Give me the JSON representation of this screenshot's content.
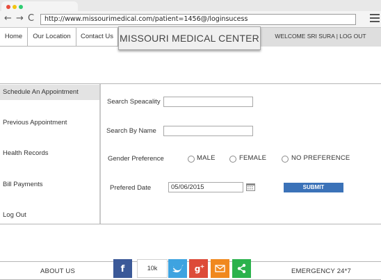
{
  "browser": {
    "url": "http://www.missourimedical.com/patient=1456@/loginsucess"
  },
  "topnav": {
    "items": [
      {
        "label": "Home"
      },
      {
        "label": "Our Location"
      },
      {
        "label": "Contact Us"
      }
    ],
    "welcome": "WELCOME SRI SURA | LOG OUT"
  },
  "logo": {
    "text": "MISSOURI MEDICAL CENTER"
  },
  "sidebar": {
    "items": [
      {
        "label": "Schedule An Appointment",
        "active": true
      },
      {
        "label": "Previous Appointment"
      },
      {
        "label": "Health Records"
      },
      {
        "label": "Bill Payments"
      },
      {
        "label": "Log Out"
      }
    ]
  },
  "form": {
    "search_specialty_label": "Search Speacality",
    "search_specialty_value": "",
    "search_name_label": "Search By Name",
    "search_name_value": "",
    "gender_label": "Gender Preference",
    "gender_options": [
      "MALE",
      "FEMALE",
      "NO PREFERENCE"
    ],
    "date_label": "Prefered Date",
    "date_value": "05/06/2015",
    "submit_label": "SUBMIT"
  },
  "footer": {
    "about": "ABOUT US",
    "emergency": "EMERGENCY 24*7",
    "share_count": "10k",
    "social": [
      {
        "name": "facebook-icon",
        "glyph": "f",
        "color": "#3b5998"
      },
      {
        "name": "twitter-icon",
        "glyph": "t",
        "color": "#3ea3e0"
      },
      {
        "name": "google-plus-icon",
        "glyph": "g+",
        "color": "#dd4b39"
      },
      {
        "name": "email-icon",
        "glyph": "✉",
        "color": "#f0881e"
      },
      {
        "name": "share-icon",
        "glyph": "<",
        "color": "#2bb24c"
      }
    ]
  },
  "colors": {
    "accent": "#3b72b8",
    "welcome_bg": "#dedede",
    "active_sidebar_bg": "#e3e3e3"
  }
}
